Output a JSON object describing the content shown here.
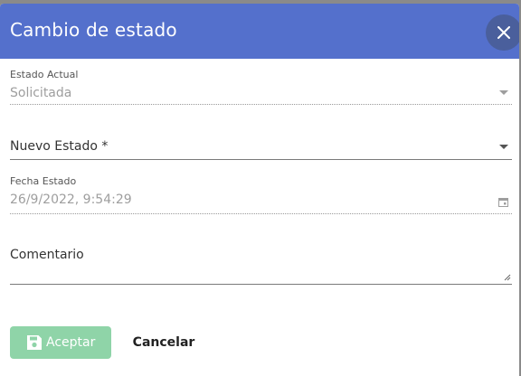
{
  "dialog": {
    "title": "Cambio de estado",
    "header_color": "#5470cc"
  },
  "fields": {
    "estado_actual": {
      "label": "Estado Actual",
      "value": "Solicitada",
      "icon": "chevron-down-icon"
    },
    "nuevo_estado": {
      "label": "Nuevo Estado *",
      "value": "",
      "icon": "chevron-down-icon"
    },
    "fecha_estado": {
      "label": "Fecha Estado",
      "value": "26/9/2022, 9:54:29",
      "icon": "calendar-icon"
    },
    "comentario": {
      "label": "Comentario",
      "value": ""
    }
  },
  "footer": {
    "accept_label": "Aceptar",
    "accept_icon": "save-icon",
    "accept_color": "#8fd4a8",
    "cancel_label": "Cancelar"
  }
}
